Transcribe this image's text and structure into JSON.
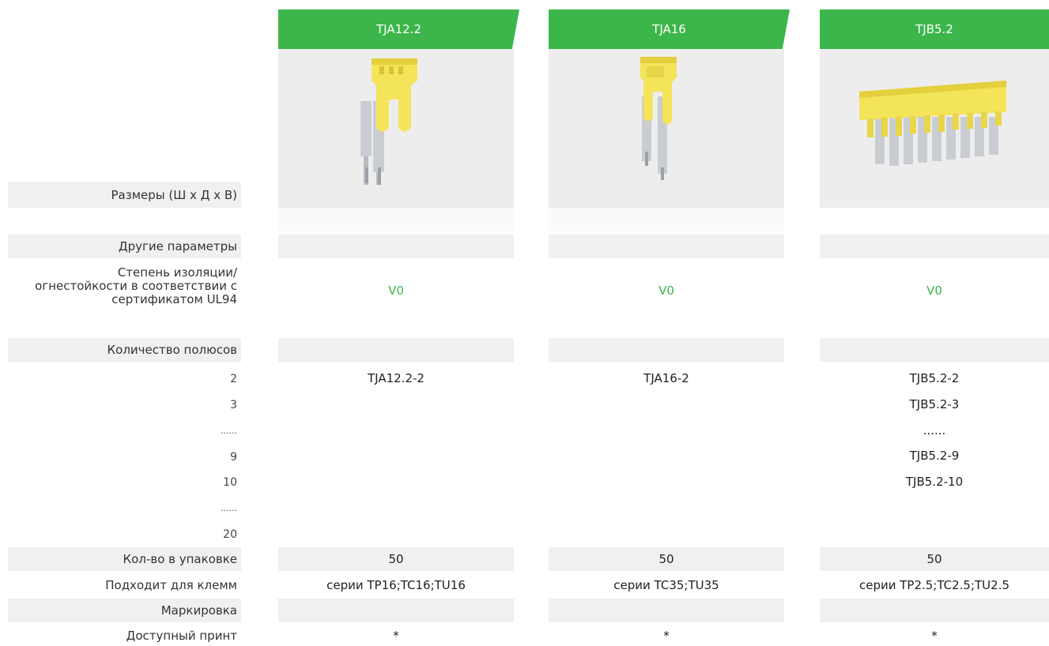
{
  "columns": [
    {
      "header": "TJA12.2",
      "insulation": "V0",
      "pole_2": "TJA12.2-2",
      "pole_3": "",
      "pole_dots1": "",
      "pole_9": "",
      "pole_10": "",
      "qty": "50",
      "fits": "серии TP16;TC16;TU16",
      "print": "*",
      "image": "yellow-2-pole-jumper"
    },
    {
      "header": "TJA16",
      "insulation": "V0",
      "pole_2": "TJA16-2",
      "pole_3": "",
      "pole_dots1": "",
      "pole_9": "",
      "pole_10": "",
      "qty": "50",
      "fits": "серии TC35;TU35",
      "print": "*",
      "image": "yellow-2-pole-jumper"
    },
    {
      "header": "TJB5.2",
      "insulation": "V0",
      "pole_2": "TJB5.2-2",
      "pole_3": "TJB5.2-3",
      "pole_dots1": "......",
      "pole_9": "TJB5.2-9",
      "pole_10": "TJB5.2-10",
      "qty": "50",
      "fits": "серии TP2.5;TC2.5;TU2.5",
      "print": "*",
      "image": "yellow-10-pole-jumper"
    }
  ],
  "labels": {
    "dimensions": "Размеры (Ш х Д х В)",
    "other_params": "Другие параметры",
    "insulation_line1": "Степень изоляции/",
    "insulation_line2": "огнестойкости в соответствии с",
    "insulation_line3": "сертификатом UL94",
    "poles": "Количество полюсов",
    "p2": "2",
    "p3": "3",
    "dots1": "......",
    "p9": "9",
    "p10": "10",
    "dots2": "......",
    "p20": "20",
    "qty": "Кол-во в упаковке",
    "fits": "Подходит для клемм",
    "marking": "Маркировка",
    "print": "Доступный принт"
  },
  "colors": {
    "accent": "#3cb64a",
    "value_green": "#3ab54a",
    "row_bg": "#f0f0f0"
  }
}
